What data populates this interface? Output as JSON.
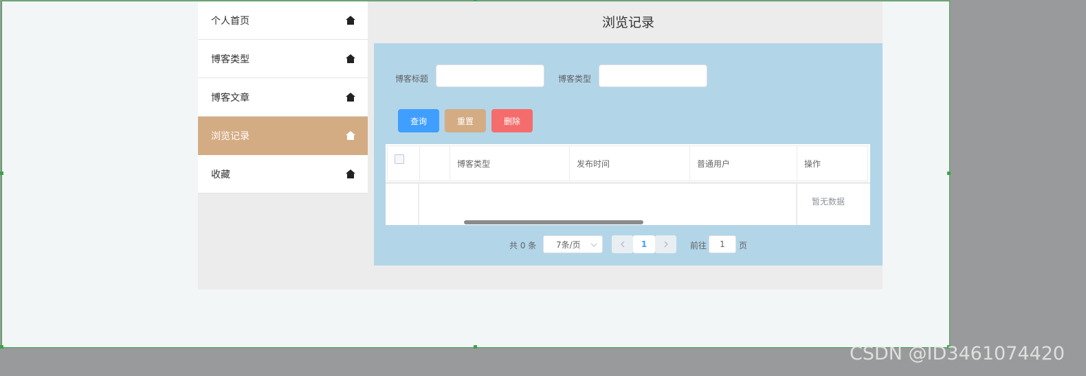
{
  "sidebar": {
    "items": [
      {
        "label": "个人首页",
        "icon": "home-icon"
      },
      {
        "label": "博客类型",
        "icon": "home-icon"
      },
      {
        "label": "博客文章",
        "icon": "home-icon"
      },
      {
        "label": "浏览记录",
        "icon": "home-icon",
        "active": true
      },
      {
        "label": "收藏",
        "icon": "home-icon"
      }
    ]
  },
  "main": {
    "title": "浏览记录",
    "search": {
      "title_label": "博客标题",
      "title_value": "",
      "type_label": "博客类型",
      "type_value": ""
    },
    "buttons": {
      "query": "查询",
      "reset": "重置",
      "delete": "删除"
    },
    "table": {
      "columns": [
        "",
        "",
        "博客类型",
        "发布时间",
        "普通用户",
        "操作"
      ],
      "empty_text": "暂无数据"
    },
    "pagination": {
      "total": "共 0 条",
      "page_size": "7条/页",
      "current_page": "1",
      "goto_label": "前往",
      "goto_value": "1",
      "page_unit": "页"
    }
  },
  "watermark": "CSDN @ID3461074420",
  "colors": {
    "active_menu": "#d4ac84",
    "panel_bg": "#b3d5e8",
    "query_button": "#409eff",
    "reset_button": "#d4ac84",
    "delete_button": "#f56c6c",
    "selection_border": "#3aa34a"
  }
}
